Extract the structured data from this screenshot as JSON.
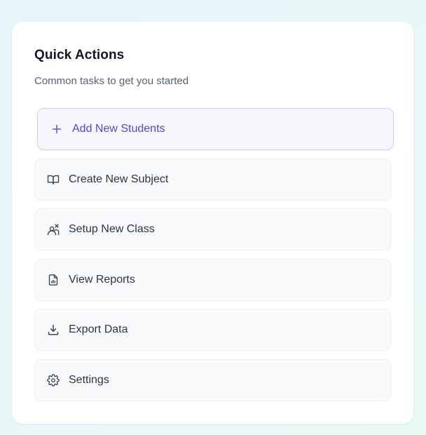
{
  "panel": {
    "title": "Quick Actions",
    "subtitle": "Common tasks to get you started"
  },
  "actions": [
    {
      "label": "Add New Students",
      "icon": "plus-icon",
      "highlighted": true
    },
    {
      "label": "Create New Subject",
      "icon": "book-open-icon"
    },
    {
      "label": "Setup New Class",
      "icon": "class-setup-icon"
    },
    {
      "label": "View Reports",
      "icon": "report-file-icon"
    },
    {
      "label": "Export Data",
      "icon": "download-icon"
    },
    {
      "label": "Settings",
      "icon": "gear-icon"
    }
  ],
  "colors": {
    "accent": "#5048d6",
    "highlight_bg": "#f6f6fd",
    "item_bg": "#f8fafc",
    "text": "#2b3544"
  }
}
